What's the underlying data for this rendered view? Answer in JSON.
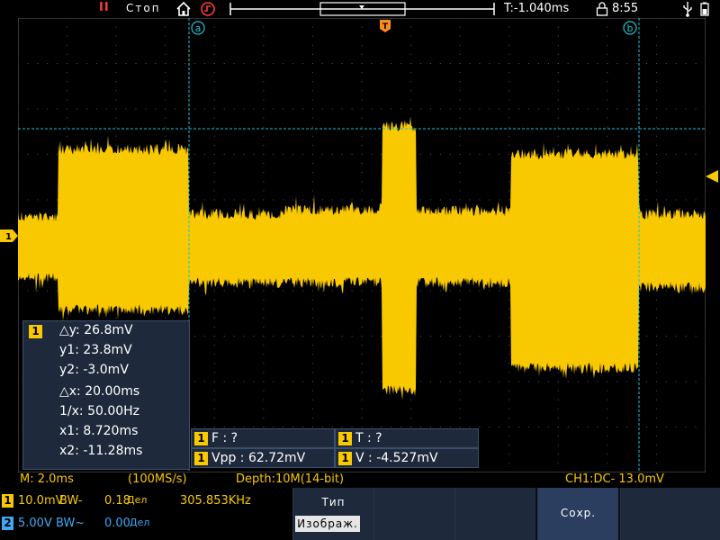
{
  "status_bar": {
    "run_icon": "pause-icon",
    "state": "Стоп",
    "trigger_time": "T:-1.040ms",
    "clock": "8:55"
  },
  "screen": {
    "cursor_a_label": "a",
    "cursor_b_label": "b",
    "trigger_marker": "T",
    "ch1_ground_marker": "1"
  },
  "cursor_measure": {
    "channel": "1",
    "dy": "△y: 26.8mV",
    "y1": "y1: 23.8mV",
    "y2": "y2: -3.0mV",
    "dx": "△x: 20.00ms",
    "inv_dx": "1/x: 50.00Hz",
    "x1": "x1: 8.720ms",
    "x2": "x2: -11.28ms"
  },
  "measurements": {
    "freq": {
      "ch": "1",
      "text": "F :   ?"
    },
    "period": {
      "ch": "1",
      "text": "T :   ?"
    },
    "vpp": {
      "ch": "1",
      "text": "Vpp : 62.72mV"
    },
    "vavg": {
      "ch": "1",
      "text": "V : -4.527mV"
    }
  },
  "info_line": {
    "timebase": "M: 2.0ms",
    "sample_rate": "(100MS/s)",
    "depth": "Depth:10M(14-bit)",
    "trigger": "CH1:DC-  13.0mV"
  },
  "channels": [
    {
      "num": "1",
      "scale": "10.0mV",
      "bw": "BW-",
      "offset": "0.18",
      "unit": "Дел",
      "freq": "305.853KHz",
      "color": "#f8c800"
    },
    {
      "num": "2",
      "scale": "5.00V",
      "bw": "BW~",
      "offset": "0.00",
      "unit": "Дел",
      "color": "#3fa9f5"
    }
  ],
  "softkeys": {
    "type_label": "Тип",
    "type_value": "Изображ.",
    "save_label": "Сохр."
  },
  "colors": {
    "ch1": "#f8c800",
    "cursor": "#19c6d6",
    "trigger": "#ff8c1a",
    "panel": "#1e2a3c"
  }
}
